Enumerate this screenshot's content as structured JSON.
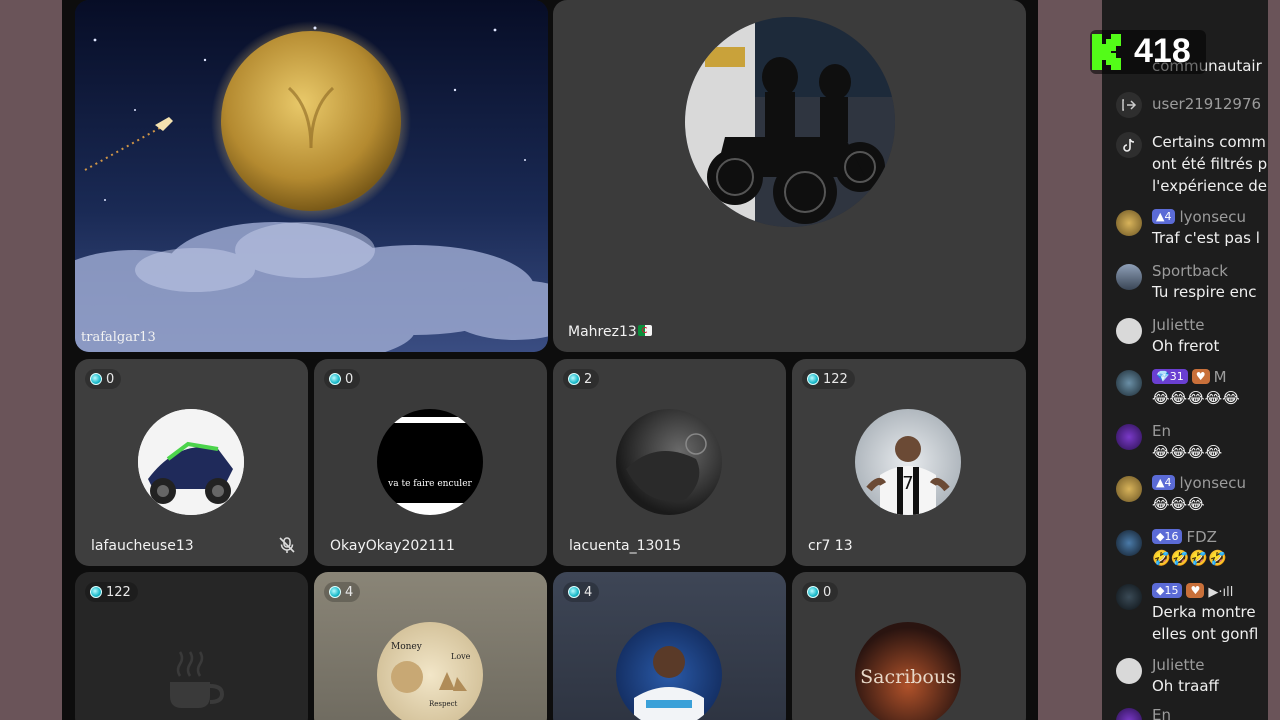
{
  "viewer_badge": {
    "count": "418",
    "logo": "kick-logo-icon",
    "accent": "#53fc18"
  },
  "main_tiles": [
    {
      "name": "trafalgar13"
    },
    {
      "name": "Mahrez13",
      "flag": "algeria-flag-icon"
    }
  ],
  "guest_row1": [
    {
      "count": "0",
      "name": "lafaucheuse13",
      "muted": true
    },
    {
      "count": "0",
      "name": "OkayOkay202111",
      "avatar_text": "va te faire enculer"
    },
    {
      "count": "2",
      "name": "lacuenta_13015"
    },
    {
      "count": "122",
      "name": "cr7 13"
    }
  ],
  "guest_row2": [
    {
      "count": "122",
      "avatar": "coffee-cup-icon"
    },
    {
      "count": "4",
      "avatar_texts": [
        "Money",
        "Love",
        "Respect"
      ]
    },
    {
      "count": "4"
    },
    {
      "count": "0",
      "avatar_text": "Sacribous"
    }
  ],
  "chat": {
    "messages": [
      {
        "user": "",
        "text": "communautair"
      },
      {
        "user": "user21912976",
        "text": "",
        "icon": "join-icon"
      },
      {
        "user": "",
        "text_lines": [
          "Certains comm",
          "ont été filtrés p",
          "l'expérience de"
        ],
        "icon": "tiktok-icon"
      },
      {
        "user": "lyonsecu",
        "badge": "4",
        "text": "Traf c'est pas l"
      },
      {
        "user": "Sportback",
        "text": "Tu respire enc"
      },
      {
        "user": "Juliette",
        "text": "Oh frerot"
      },
      {
        "user": "M",
        "badge": "31",
        "text": "😂😂😂😂😂"
      },
      {
        "user": "En",
        "text": "😂😂😂😂"
      },
      {
        "user": "lyonsecu",
        "badge": "4",
        "text": "😂😂😂"
      },
      {
        "user": "FDZ",
        "badge": "16",
        "text": "🤣🤣🤣🤣"
      },
      {
        "user": "",
        "badge": "15",
        "text_lines": [
          "Derka montre",
          "elles ont gonfl"
        ]
      },
      {
        "user": "Juliette",
        "text": "Oh traaff"
      },
      {
        "user": "En",
        "text": ""
      }
    ]
  }
}
